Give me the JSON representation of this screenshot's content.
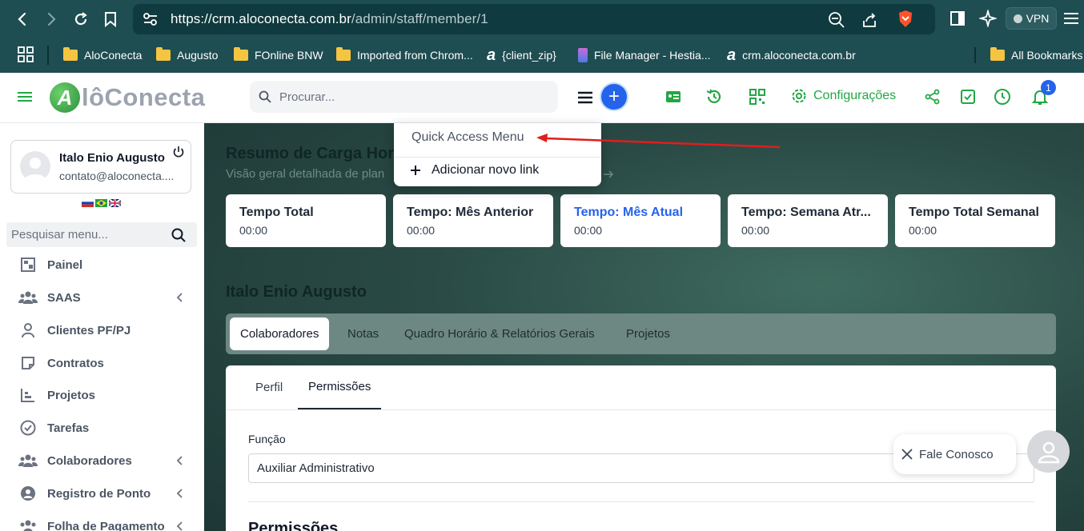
{
  "browser": {
    "url_host": "https://crm.aloconecta.com.br",
    "url_path": "/admin/staff/member/1",
    "vpn_label": "VPN"
  },
  "bookmarks": [
    {
      "label": "AloConecta",
      "icon": "folder-icon"
    },
    {
      "label": "Augusto",
      "icon": "folder-icon"
    },
    {
      "label": "FOnline BNW",
      "icon": "folder-icon"
    },
    {
      "label": "Imported from Chrom...",
      "icon": "folder-icon"
    },
    {
      "label": "{client_zip}",
      "icon": "aloconecta-favicon"
    },
    {
      "label": "File Manager - Hestia...",
      "icon": "hestia-favicon"
    },
    {
      "label": "crm.aloconecta.com.br",
      "icon": "aloconecta-favicon"
    },
    {
      "label": "All Bookmarks",
      "icon": "folder-icon"
    }
  ],
  "header": {
    "logo_letter": "A",
    "logo_text": "lôConecta",
    "search_placeholder": "Procurar...",
    "config_label": "Configurações",
    "notification_count": "1",
    "accent_color": "#22a744"
  },
  "quick_menu": {
    "title": "Quick Access Menu",
    "add_label": "Adicionar novo link"
  },
  "sidebar": {
    "user_name": "Italo Enio Augusto",
    "user_email": "contato@aloconecta....",
    "search_placeholder": "Pesquisar menu...",
    "items": [
      {
        "label": "Painel",
        "icon": "dashboard-icon",
        "has_children": false
      },
      {
        "label": "SAAS",
        "icon": "users-group-icon",
        "has_children": true
      },
      {
        "label": "Clientes PF/PJ",
        "icon": "user-icon",
        "has_children": false
      },
      {
        "label": "Contratos",
        "icon": "contract-icon",
        "has_children": false
      },
      {
        "label": "Projetos",
        "icon": "chart-icon",
        "has_children": false
      },
      {
        "label": "Tarefas",
        "icon": "check-circle-icon",
        "has_children": false
      },
      {
        "label": "Colaboradores",
        "icon": "users-group-icon",
        "has_children": true
      },
      {
        "label": "Registro de Ponto",
        "icon": "user-circle-icon",
        "has_children": true
      },
      {
        "label": "Folha de Pagamento",
        "icon": "users-group-icon",
        "has_children": true
      }
    ]
  },
  "main": {
    "title": "Resumo de Carga Hor",
    "subtitle": "Visão geral detalhada de plan",
    "stats": [
      {
        "title": "Tempo Total",
        "value": "00:00",
        "active": false
      },
      {
        "title": "Tempo: Mês Anterior",
        "value": "00:00",
        "active": false
      },
      {
        "title": "Tempo: Mês Atual",
        "value": "00:00",
        "active": true
      },
      {
        "title": "Tempo: Semana Atr...",
        "value": "00:00",
        "active": false
      },
      {
        "title": "Tempo Total Semanal",
        "value": "00:00",
        "active": false
      }
    ],
    "member_name": "Italo Enio Augusto",
    "tabs": [
      "Colaboradores",
      "Notas",
      "Quadro Horário & Relatórios Gerais",
      "Projetos"
    ],
    "subtabs": [
      "Perfil",
      "Permissões"
    ],
    "field_label": "Função",
    "field_value": "Auxiliar Administrativo",
    "permissions_heading": "Permissões"
  },
  "chat": {
    "label": "Fale Conosco"
  }
}
